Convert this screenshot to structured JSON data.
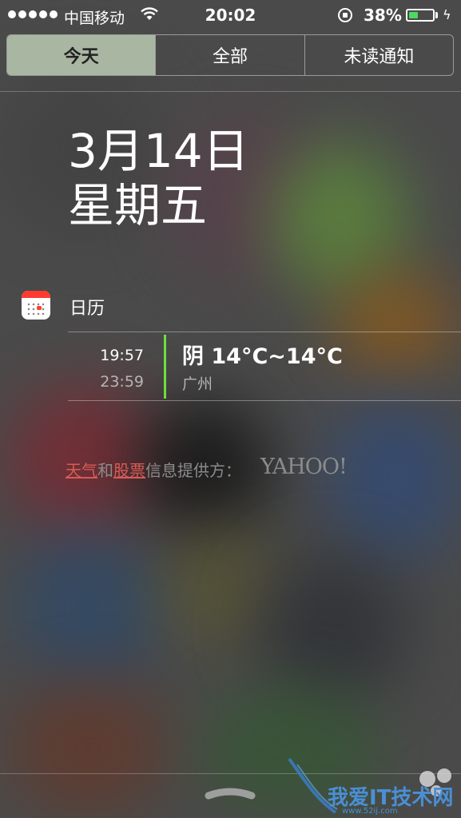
{
  "status_bar": {
    "carrier": "中国移动",
    "time": "20:02",
    "battery_percent": "38%",
    "battery_level": 0.38,
    "battery_color": "#4cd964"
  },
  "segments": [
    {
      "label": "今天",
      "active": true
    },
    {
      "label": "全部",
      "active": false
    },
    {
      "label": "未读通知",
      "active": false
    }
  ],
  "today": {
    "date": "3月14日",
    "weekday": "星期五"
  },
  "calendar": {
    "title": "日历",
    "icon": "calendar-icon",
    "event": {
      "start": "19:57",
      "end": "23:59",
      "title": "阴 14°C~14°C",
      "location": "广州",
      "bar_color": "#6ce13c"
    }
  },
  "credit": {
    "weather_link": "天气",
    "and": "和",
    "stocks_link": "股票",
    "suffix": "信息提供方：",
    "provider": "YAHOO!"
  },
  "watermark": {
    "text": "我爱IT技术网",
    "url": "www.52ij.com"
  }
}
